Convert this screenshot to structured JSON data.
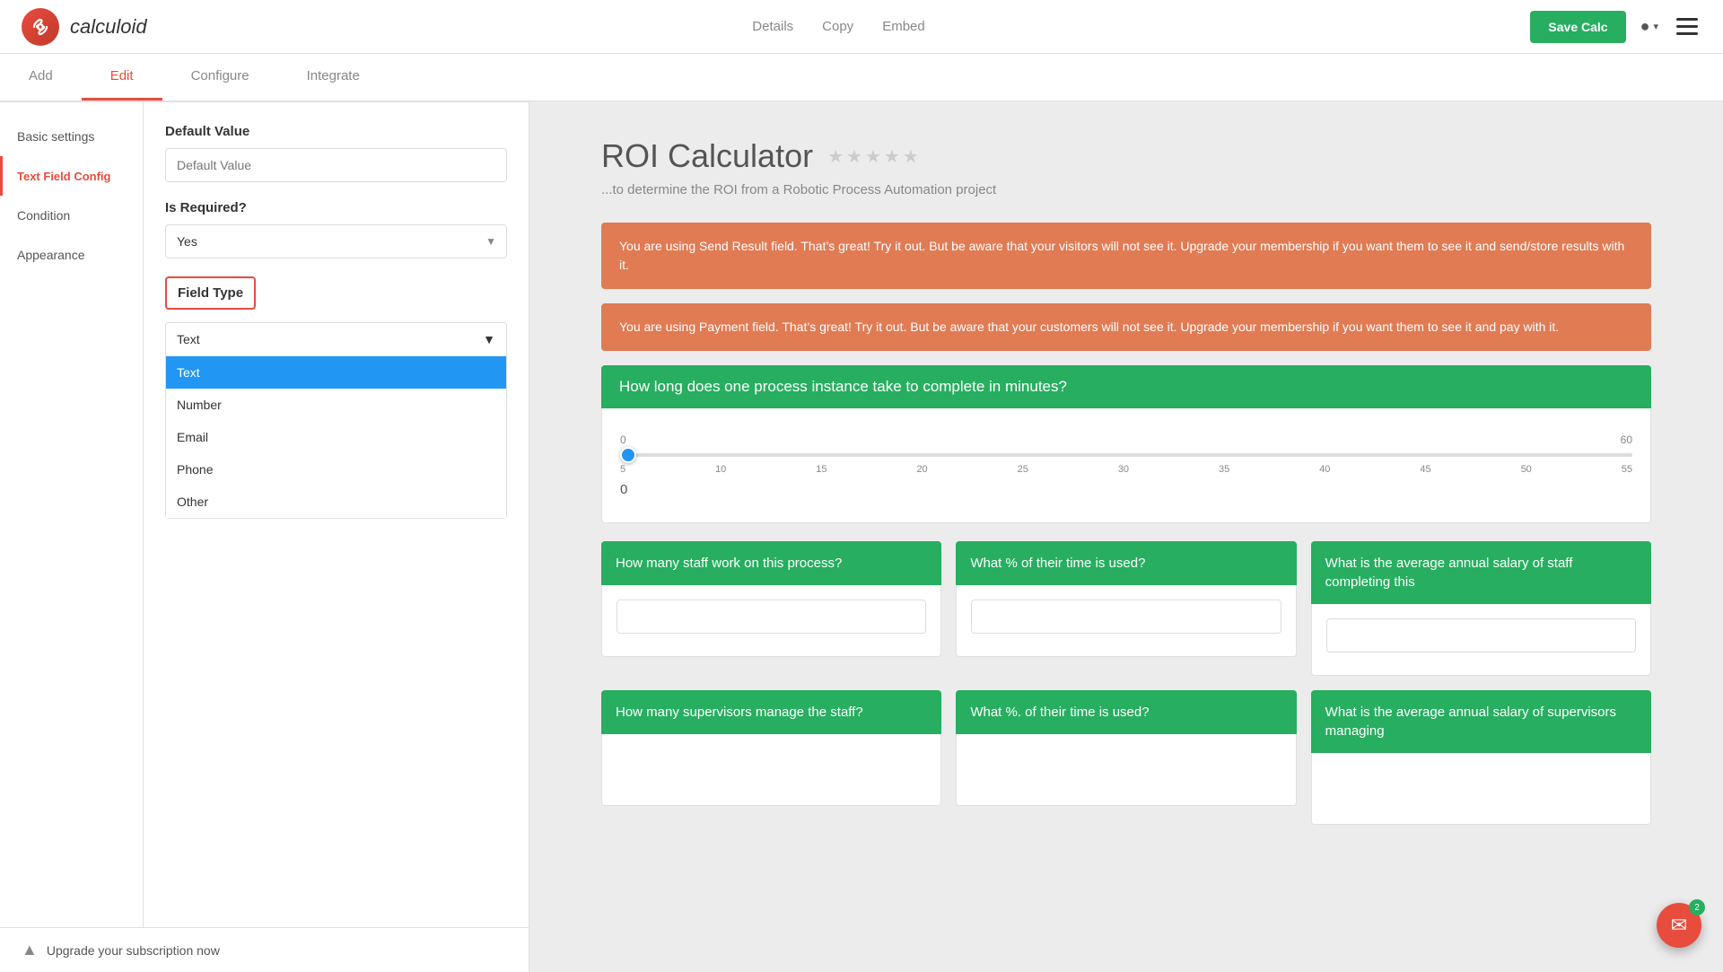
{
  "app": {
    "logo_symbol": "∞",
    "logo_text": "calculoid"
  },
  "header": {
    "nav": [
      {
        "id": "details",
        "label": "Details"
      },
      {
        "id": "copy",
        "label": "Copy"
      },
      {
        "id": "embed",
        "label": "Embed"
      }
    ],
    "save_label": "Save Calc"
  },
  "tabs": [
    {
      "id": "add",
      "label": "Add",
      "active": false
    },
    {
      "id": "edit",
      "label": "Edit",
      "active": true
    },
    {
      "id": "configure",
      "label": "Configure",
      "active": false
    },
    {
      "id": "integrate",
      "label": "Integrate",
      "active": false
    }
  ],
  "sidebar": {
    "items": [
      {
        "id": "basic-settings",
        "label": "Basic settings",
        "active": false
      },
      {
        "id": "text-field-config",
        "label": "Text Field Config",
        "active": true
      },
      {
        "id": "condition",
        "label": "Condition",
        "active": false
      },
      {
        "id": "appearance",
        "label": "Appearance",
        "active": false
      }
    ]
  },
  "form": {
    "default_value_label": "Default Value",
    "default_value_placeholder": "Default Value",
    "is_required_label": "Is Required?",
    "is_required_value": "Yes",
    "field_type_label": "Field Type",
    "field_type_value": "Text",
    "dropdown_options": [
      {
        "id": "text",
        "label": "Text",
        "selected": true
      },
      {
        "id": "number",
        "label": "Number",
        "selected": false
      },
      {
        "id": "email",
        "label": "Email",
        "selected": false
      },
      {
        "id": "phone",
        "label": "Phone",
        "selected": false
      },
      {
        "id": "other",
        "label": "Other",
        "selected": false
      }
    ]
  },
  "upgrade": {
    "label": "Upgrade your subscription now"
  },
  "preview": {
    "title": "ROI Calculator",
    "subtitle": "...to determine the ROI from a Robotic Process Automation project",
    "alert1": "You are using Send Result field. That’s great! Try it out. But be aware that your visitors will not see it. Upgrade your membership if you want them to see it and send/store results with it.",
    "alert2": "You are using Payment field. That’s great! Try it out. But be aware that your customers will not see it. Upgrade your membership if you want them to see it and pay with it.",
    "slider_question": "How long does one process instance take to complete in minutes?",
    "slider_min": "0",
    "slider_max": "60",
    "slider_value": "0",
    "slider_ticks": [
      "0",
      "5",
      "10",
      "15",
      "20",
      "25",
      "30",
      "35",
      "40",
      "45",
      "50",
      "55",
      "60"
    ],
    "grid_questions": [
      {
        "header": "How many staff work on this process?",
        "has_input": true
      },
      {
        "header": "What % of their time is used?",
        "has_input": true
      },
      {
        "header": "What is the average annual salary of staff completing this",
        "has_input": true
      }
    ],
    "grid_questions2": [
      {
        "header": "How many supervisors manage the staff?",
        "has_input": false
      },
      {
        "header": "What %. of their time is used?",
        "has_input": false
      },
      {
        "header": "What is the average annual salary of supervisors managing",
        "has_input": false
      }
    ],
    "chat_badge": "2"
  }
}
